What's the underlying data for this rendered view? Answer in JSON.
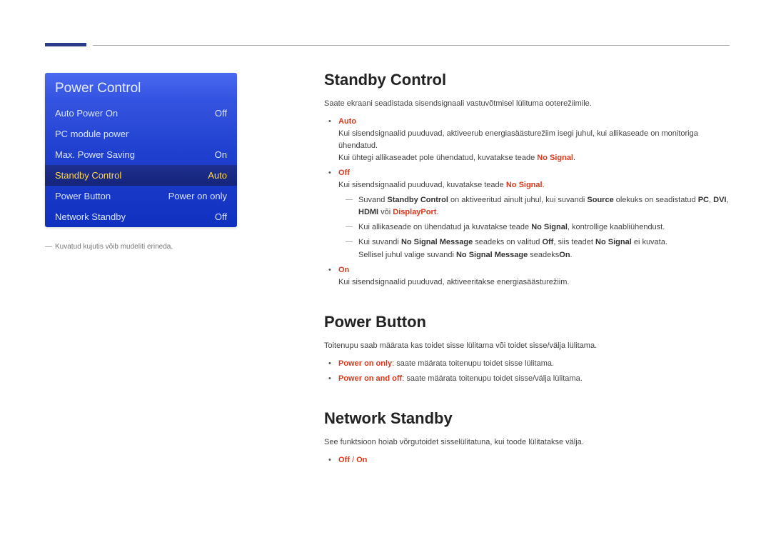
{
  "menu": {
    "title": "Power Control",
    "items": [
      {
        "label": "Auto Power On",
        "value": "Off",
        "selected": false
      },
      {
        "label": "PC module power",
        "value": "",
        "selected": false
      },
      {
        "label": "Max. Power Saving",
        "value": "On",
        "selected": false
      },
      {
        "label": "Standby Control",
        "value": "Auto",
        "selected": true
      },
      {
        "label": "Power Button",
        "value": "Power on only",
        "selected": false
      },
      {
        "label": "Network Standby",
        "value": "Off",
        "selected": false
      }
    ],
    "footnote": "Kuvatud kujutis võib mudeliti erineda."
  },
  "sections": {
    "standby": {
      "heading": "Standby Control",
      "intro": "Saate ekraani seadistada sisendsignaali vastuvõtmisel lülituma ooterežiimile.",
      "auto_label": "Auto",
      "auto_line1": "Kui sisendsignaalid puuduvad, aktiveerub energiasäästurežiim isegi juhul, kui allikaseade on monitoriga ühendatud.",
      "auto_line2_a": "Kui ühtegi allikaseadet pole ühendatud, kuvatakse teade ",
      "auto_line2_b": "No Signal",
      "auto_line2_c": ".",
      "off_label": "Off",
      "off_line1_a": "Kui sisendsignaalid puuduvad, kuvatakse teade ",
      "off_line1_b": "No Signal",
      "off_line1_c": ".",
      "off_note1_a": "Suvand ",
      "off_note1_b": "Standby Control",
      "off_note1_c": " on aktiveeritud ainult juhul, kui suvandi ",
      "off_note1_d": "Source",
      "off_note1_e": " olekuks on seadistatud ",
      "off_note1_f": "PC",
      "off_note1_g": ", ",
      "off_note1_h": "DVI",
      "off_note1_i": ", ",
      "off_note1_j": "HDMI",
      "off_note1_k": " või ",
      "off_note1_l": "DisplayPort",
      "off_note1_m": ".",
      "off_note2_a": "Kui allikaseade on ühendatud ja kuvatakse teade ",
      "off_note2_b": "No Signal",
      "off_note2_c": ", kontrollige kaabliühendust.",
      "off_note3_a": "Kui suvandi ",
      "off_note3_b": "No Signal Message",
      "off_note3_c": " seadeks on valitud ",
      "off_note3_d": "Off",
      "off_note3_e": ", siis teadet ",
      "off_note3_f": "No Signal",
      "off_note3_g": " ei kuvata.",
      "off_note3_line2_a": "Sellisel juhul valige suvandi ",
      "off_note3_line2_b": "No Signal Message",
      "off_note3_line2_c": " seadeks",
      "off_note3_line2_d": "On",
      "off_note3_line2_e": ".",
      "on_label": "On",
      "on_line": "Kui sisendsignaalid puuduvad, aktiveeritakse energiasäästurežiim."
    },
    "powerbutton": {
      "heading": "Power Button",
      "intro": "Toitenupu saab määrata kas toidet sisse lülitama või toidet sisse/välja lülitama.",
      "opt1_a": "Power on only",
      "opt1_b": ": saate määrata toitenupu toidet sisse lülitama.",
      "opt2_a": "Power on and off",
      "opt2_b": ": saate määrata toitenupu toidet sisse/välja lülitama."
    },
    "network": {
      "heading": "Network Standby",
      "intro": "See funktsioon hoiab võrgutoidet sisselülitatuna, kui toode lülitatakse välja.",
      "opt_a": "Off",
      "opt_sep": " / ",
      "opt_b": "On"
    }
  }
}
